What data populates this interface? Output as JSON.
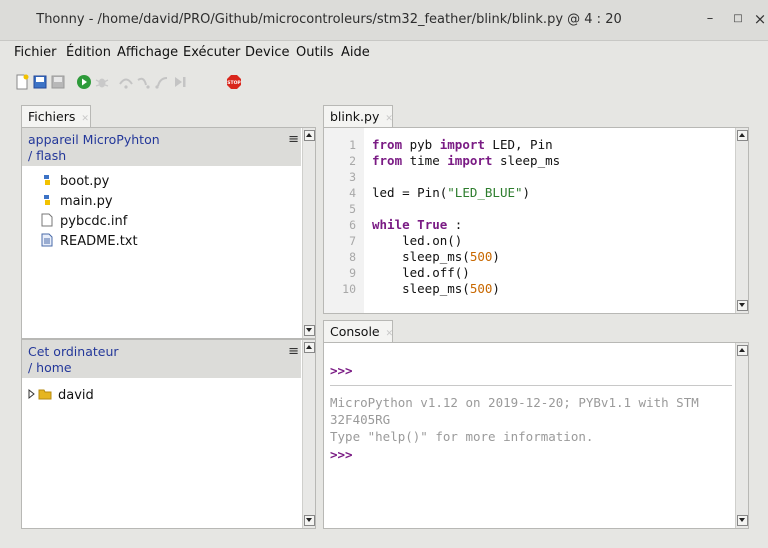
{
  "window": {
    "title": "Thonny - /home/david/PRO/Github/microcontroleurs/stm32_feather/blink/blink.py @ 4 : 20",
    "minimize": "–",
    "maximize": "□",
    "close": "×"
  },
  "menu": [
    "Fichier",
    "Édition",
    "Affichage",
    "Exécuter",
    "Device",
    "Outils",
    "Aide"
  ],
  "files": {
    "tab_label": "Fichiers",
    "device": {
      "header_line1": "appareil MicroPyhton",
      "header_line2": "/ flash",
      "menu_glyph": "≡",
      "items": [
        "boot.py",
        "main.py",
        "pybcdc.inf",
        "README.txt"
      ]
    },
    "computer": {
      "header_line1": "Cet ordinateur",
      "header_line2": "/ home",
      "menu_glyph": "≡",
      "items": [
        "david"
      ]
    }
  },
  "editor": {
    "tab_label": "blink.py",
    "line_numbers": [
      "1",
      "2",
      "3",
      "4",
      "5",
      "6",
      "7",
      "8",
      "9",
      "10"
    ]
  },
  "console": {
    "tab_label": "Console",
    "prompt": ">>>",
    "info_line1": "MicroPython v1.12 on 2019-12-20; PYBv1.1 with STM",
    "info_line2": "32F405RG",
    "info_line3": "Type \"help()\" for more information.",
    "prompt2": ">>>"
  },
  "colors": {
    "keyword": "#7a1b84",
    "string": "#2d7d2d",
    "number": "#c86800",
    "header_link": "#24389a",
    "stop_button": "#d9261c",
    "run_button": "#2e9b3a"
  },
  "toolbar_icons": [
    "new-file-icon",
    "open-file-icon",
    "save-file-icon",
    "run-icon",
    "debug-icon",
    "step-over-icon",
    "step-into-icon",
    "step-out-icon",
    "resume-icon",
    "stop-icon"
  ]
}
